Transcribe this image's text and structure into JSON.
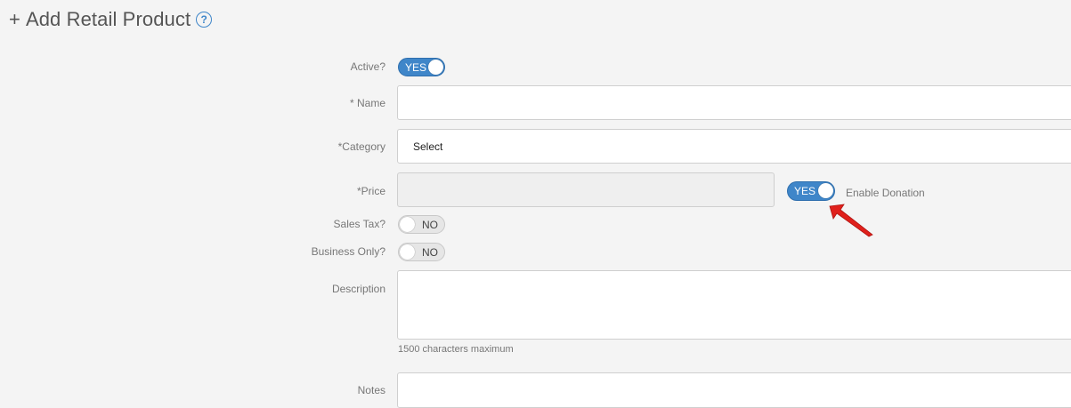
{
  "header": {
    "plus": "+",
    "title": "Add Retail Product",
    "help_glyph": "?"
  },
  "form": {
    "active": {
      "label": "Active?",
      "toggle": "YES",
      "on": true
    },
    "name": {
      "label": "* Name",
      "value": ""
    },
    "category": {
      "label": "*Category",
      "value": "Select"
    },
    "price": {
      "label": "*Price",
      "value": ""
    },
    "donation": {
      "toggle": "YES",
      "on": true,
      "label": "Enable Donation"
    },
    "sales_tax": {
      "label": "Sales Tax?",
      "toggle": "NO",
      "on": false
    },
    "business_only": {
      "label": "Business Only?",
      "toggle": "NO",
      "on": false
    },
    "description": {
      "label": "Description",
      "value": "",
      "hint": "1500 characters maximum"
    },
    "notes": {
      "label": "Notes",
      "value": ""
    }
  },
  "colors": {
    "accent": "#3f86c9",
    "annotation_arrow": "#e0201b",
    "background": "#f4f4f4"
  }
}
